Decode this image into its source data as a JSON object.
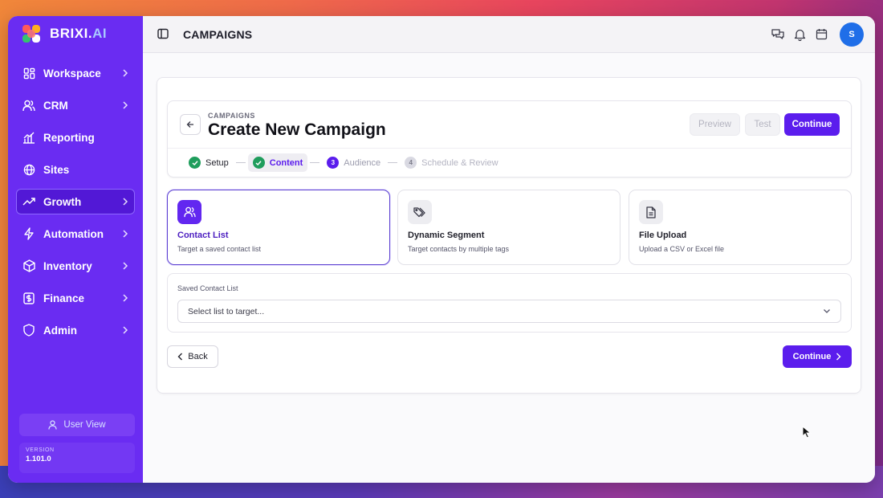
{
  "brand": {
    "name_main": "BRIXI.",
    "name_accent": "AI",
    "colors": [
      "#ff5a5a",
      "#ffb020",
      "#36c26e",
      "#6a3df0"
    ]
  },
  "sidebar": {
    "items": [
      {
        "label": "Workspace",
        "icon": "grid-icon",
        "active": false,
        "chevron": true
      },
      {
        "label": "CRM",
        "icon": "users-icon",
        "active": false,
        "chevron": true
      },
      {
        "label": "Reporting",
        "icon": "chart-icon",
        "active": false,
        "chevron": false
      },
      {
        "label": "Sites",
        "icon": "globe-icon",
        "active": false,
        "chevron": false
      },
      {
        "label": "Growth",
        "icon": "trending-icon",
        "active": true,
        "chevron": true
      },
      {
        "label": "Automation",
        "icon": "bolt-icon",
        "active": false,
        "chevron": true
      },
      {
        "label": "Inventory",
        "icon": "box-icon",
        "active": false,
        "chevron": true
      },
      {
        "label": "Finance",
        "icon": "dollar-icon",
        "active": false,
        "chevron": true
      },
      {
        "label": "Admin",
        "icon": "shield-icon",
        "active": false,
        "chevron": true
      }
    ],
    "user_view": "User View",
    "version_label": "VERSION",
    "version": "1.101.0"
  },
  "topbar": {
    "title": "CAMPAIGNS",
    "avatar_initial": "S"
  },
  "header": {
    "crumb": "CAMPAIGNS",
    "title": "Create New Campaign",
    "preview": "Preview",
    "test": "Test",
    "continue": "Continue"
  },
  "steps": [
    {
      "label": "Setup",
      "status": "done",
      "num": ""
    },
    {
      "label": "Content",
      "status": "current-done",
      "num": ""
    },
    {
      "label": "Audience",
      "status": "numbered",
      "num": "3"
    },
    {
      "label": "Schedule & Review",
      "status": "pending",
      "num": "4"
    }
  ],
  "options": [
    {
      "title": "Contact List",
      "desc": "Target a saved contact list",
      "icon": "users-icon",
      "selected": true
    },
    {
      "title": "Dynamic Segment",
      "desc": "Target contacts by multiple tags",
      "icon": "tags-icon",
      "selected": false
    },
    {
      "title": "File Upload",
      "desc": "Upload a CSV or Excel file",
      "icon": "file-icon",
      "selected": false
    }
  ],
  "list": {
    "label": "Saved Contact List",
    "placeholder": "Select list to target..."
  },
  "footer": {
    "back": "Back",
    "continue": "Continue"
  },
  "colors": {
    "sidebar": "#6a2cf2",
    "accent": "#5b1ded",
    "success": "#1f9d5c"
  }
}
